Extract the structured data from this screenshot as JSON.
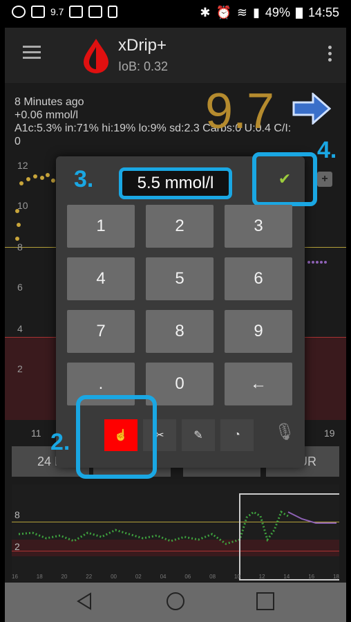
{
  "status_bar": {
    "battery": "49%",
    "time": "14:55",
    "speed": "9.7"
  },
  "app": {
    "title": "xDrip+",
    "iob": "IoB: 0.32"
  },
  "info": {
    "ago": "8 Minutes ago",
    "delta": "+0.06 mmol/l",
    "stats": "A1c:5.3% in:71% hi:19% lo:9% sd:2.3 Carbs:0 U:0.4 C/I:",
    "stats_cont": "0",
    "bg_value": "9.7"
  },
  "chart": {
    "y_labels": [
      "12",
      "10",
      "8",
      "6",
      "4",
      "2"
    ],
    "x_left": "11",
    "x_right": "19"
  },
  "dialog": {
    "value": "5.5 mmol/l",
    "keys": [
      "1",
      "2",
      "3",
      "4",
      "5",
      "6",
      "7",
      "8",
      "9",
      ".",
      "0",
      "←"
    ]
  },
  "tabs": {
    "left": "24 H",
    "right": "OUR"
  },
  "callouts": {
    "c2": "2.",
    "c3": "3.",
    "c4": "4."
  },
  "preview": {
    "y_labels": [
      "8",
      "2"
    ],
    "x_ticks": [
      "16",
      "18",
      "20",
      "22",
      "00",
      "02",
      "04",
      "06",
      "08",
      "10",
      "12",
      "14",
      "16",
      "18"
    ]
  },
  "icons": {
    "ok": "check-icon",
    "backspace": "←"
  }
}
